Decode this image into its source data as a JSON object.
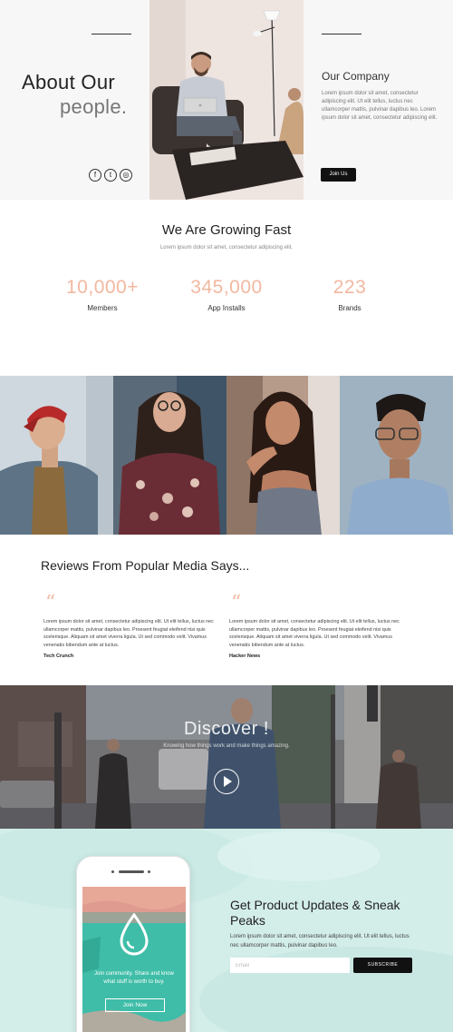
{
  "hero": {
    "title_line1": "About Our",
    "title_line2": "people.",
    "social": [
      {
        "icon": "facebook-icon",
        "glyph": "f"
      },
      {
        "icon": "twitter-icon",
        "glyph": "t"
      },
      {
        "icon": "instagram-icon",
        "glyph": "◎"
      }
    ],
    "company_heading": "Our Company",
    "company_text": "Lorem ipsum dolor sit amet, consectetur adipiscing elit. Ut elit tellus, luctus nec ullamcorper mattis, pulvinar dapibus leo.  Lorem ipsum dolor sit amet, consectetur adipiscing elit.",
    "join_button": "Join Us"
  },
  "stats": {
    "title": "We Are Growing Fast",
    "subtitle": "Lorem ipsum dolor sit amet, consectetur adipiscing elit.",
    "items": [
      {
        "value": "10,000+",
        "label": "Members"
      },
      {
        "value": "345,000",
        "label": "App Installs"
      },
      {
        "value": "223",
        "label": "Brands"
      }
    ],
    "accent_color": "#f2b8a0"
  },
  "reviews": {
    "title": "Reviews From Popular Media Says...",
    "items": [
      {
        "quote_mark": "“",
        "text": "Lorem ipsum dolor sit amet, consectetur adipiscing elit. Ut elit tellus, luctus nec ullamcorper mattis, pulvinar dapibus leo. Proesent feugiat eleifend nisi quis scelerisque. Aliquam sit amet viverra ligula. Ut sed commodo velit. Vivamus venenatis bibendum ante at luctus.",
        "source": "Tech Crunch"
      },
      {
        "quote_mark": "“",
        "text": "Lorem ipsum dolor sit amet, consectetur adipiscing elit. Ut elit tellus, luctus nec ullamcorper mattis, pulvinar dapibus leo. Proesent feugiat eleifend nisi quis scelerisque. Aliquam sit amet viverra ligula. Ut sed commodo velit. Vivamus venenatis bibendum ante at luctus.",
        "source": "Hacker News"
      }
    ]
  },
  "discover": {
    "title": "Discover !",
    "subtitle": "Knowing how things work and make things amazing."
  },
  "updates": {
    "title": "Get Product Updates & Sneak Peaks",
    "text": "Lorem ipsum dolor sit amet, consectetur adipiscing elit. Ut elit tellus, luctus nec ullamcorper mattis, pulvinar dapibus leo.",
    "email_placeholder": "Email",
    "subscribe_button": "SUBSCRIBE",
    "phone_text": "Join community. Share and know what stuff is worth to buy.",
    "phone_button": "Join Now",
    "bg_color": "#d3ede9",
    "phone_accent": "#39b9a5"
  }
}
